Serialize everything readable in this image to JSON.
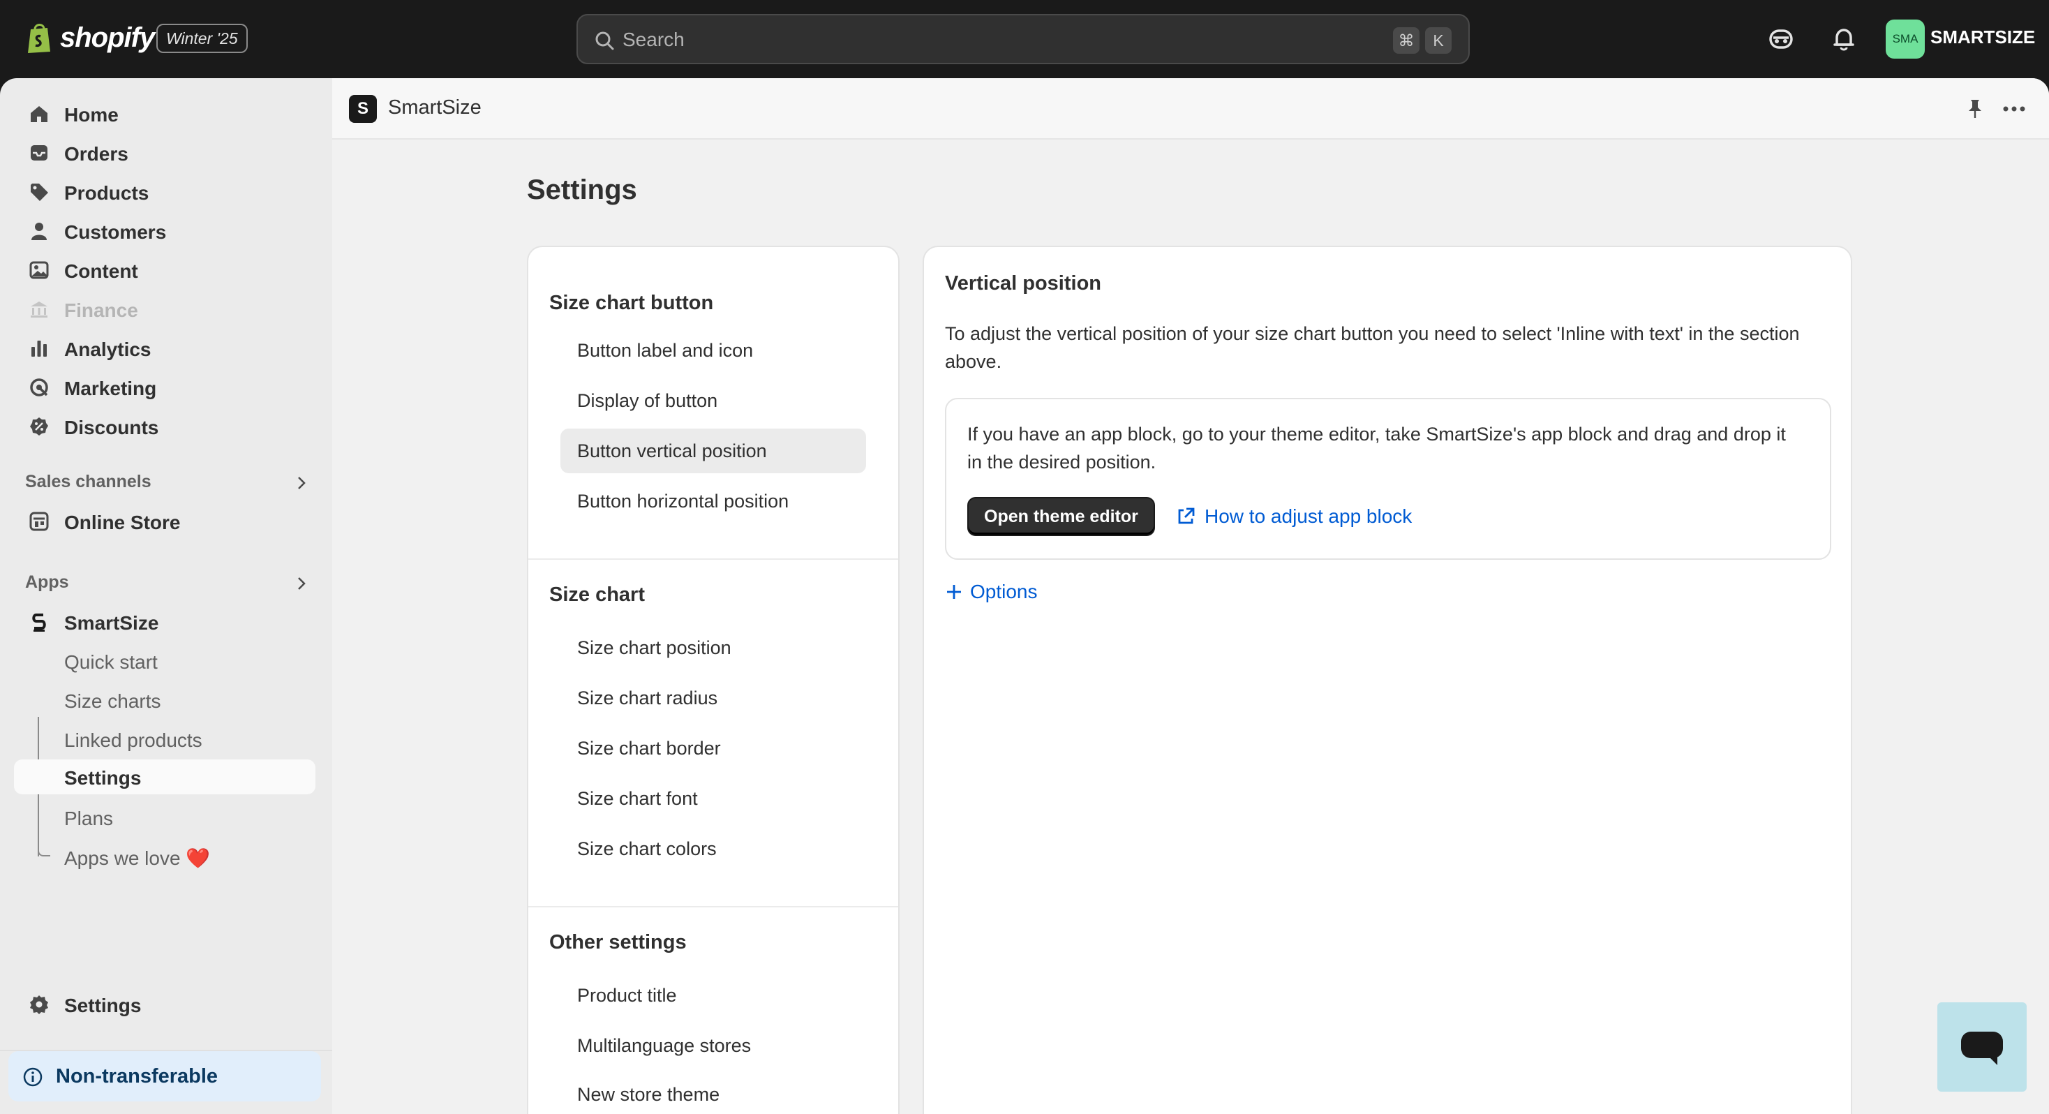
{
  "topbar": {
    "brand": "shopify",
    "edition": "Winter '25",
    "search_placeholder": "Search",
    "shortcut_key1": "⌘",
    "shortcut_key2": "K",
    "store_initials": "SMA",
    "store_name": "SMARTSIZE"
  },
  "sidebar": {
    "nav": [
      {
        "label": "Home",
        "icon": "home-icon"
      },
      {
        "label": "Orders",
        "icon": "orders-icon"
      },
      {
        "label": "Products",
        "icon": "tag-icon"
      },
      {
        "label": "Customers",
        "icon": "person-icon"
      },
      {
        "label": "Content",
        "icon": "image-icon"
      },
      {
        "label": "Finance",
        "icon": "bank-icon",
        "disabled": true
      },
      {
        "label": "Analytics",
        "icon": "bar-chart-icon"
      },
      {
        "label": "Marketing",
        "icon": "target-icon"
      },
      {
        "label": "Discounts",
        "icon": "discount-icon"
      }
    ],
    "sales_channels_heading": "Sales channels",
    "online_store": "Online Store",
    "apps_heading": "Apps",
    "app_name": "SmartSize",
    "app_subitems": [
      "Quick start",
      "Size charts",
      "Linked products",
      "Settings",
      "Plans",
      "Apps we love ❤️"
    ],
    "active_subitem": "Settings",
    "settings": "Settings",
    "non_transferable": "Non-transferable"
  },
  "app_header": {
    "logo_letter": "S",
    "title": "SmartSize"
  },
  "page": {
    "title": "Settings",
    "groups": [
      {
        "title": "Size chart button",
        "items": [
          "Button label and icon",
          "Display of button",
          "Button vertical position",
          "Button horizontal position"
        ]
      },
      {
        "title": "Size chart",
        "items": [
          "Size chart position",
          "Size chart radius",
          "Size chart border",
          "Size chart font",
          "Size chart colors"
        ]
      },
      {
        "title": "Other settings",
        "items": [
          "Product title",
          "Multilanguage stores",
          "New store theme"
        ]
      }
    ],
    "selected_item": "Button vertical position",
    "detail": {
      "title": "Vertical position",
      "description": "To adjust the vertical position of your size chart button you need to select 'Inline with text' in the section above.",
      "info_text": "If you have an app block, go to your theme editor, take SmartSize's app block and drag and drop it in the desired position.",
      "primary_button": "Open theme editor",
      "help_link": "How to adjust app block",
      "options_link": "Options"
    }
  },
  "colors": {
    "topbar_bg": "#1a1a1a",
    "sidebar_bg": "#ebebeb",
    "main_bg": "#f1f1f1",
    "link": "#005bd3",
    "avatar": "#6fe09a",
    "chat_widget": "#bde2ea"
  }
}
